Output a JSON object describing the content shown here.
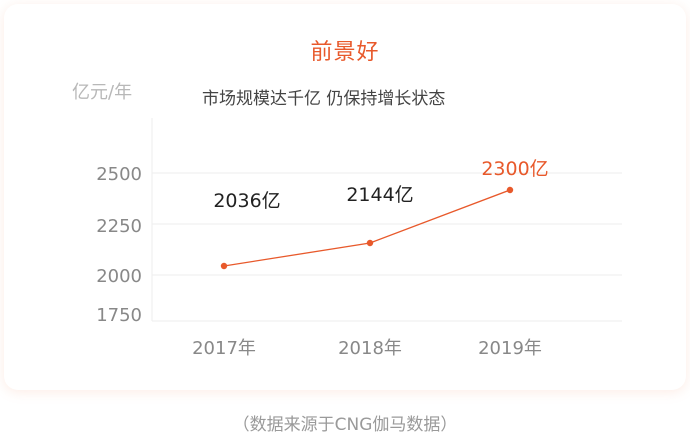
{
  "colors": {
    "accent": "#e8592b",
    "label_dark": "#222222",
    "grid": "#eeeeee",
    "axis_text": "#888888"
  },
  "chart_data": {
    "type": "line",
    "title": "前景好",
    "subtitle": "市场规模达千亿 仍保持增长状态",
    "ylabel": "亿元/年",
    "xlabel": "",
    "categories": [
      "2017年",
      "2018年",
      "2019年"
    ],
    "values": [
      2036,
      2144,
      2300
    ],
    "data_labels": [
      "2036亿",
      "2144亿",
      "2300亿"
    ],
    "yticks": [
      1750,
      2000,
      2250,
      2500
    ],
    "ylim": [
      1750,
      2500
    ],
    "grid": true,
    "legend": "none",
    "source": "（数据来源于CNG伽马数据）"
  }
}
